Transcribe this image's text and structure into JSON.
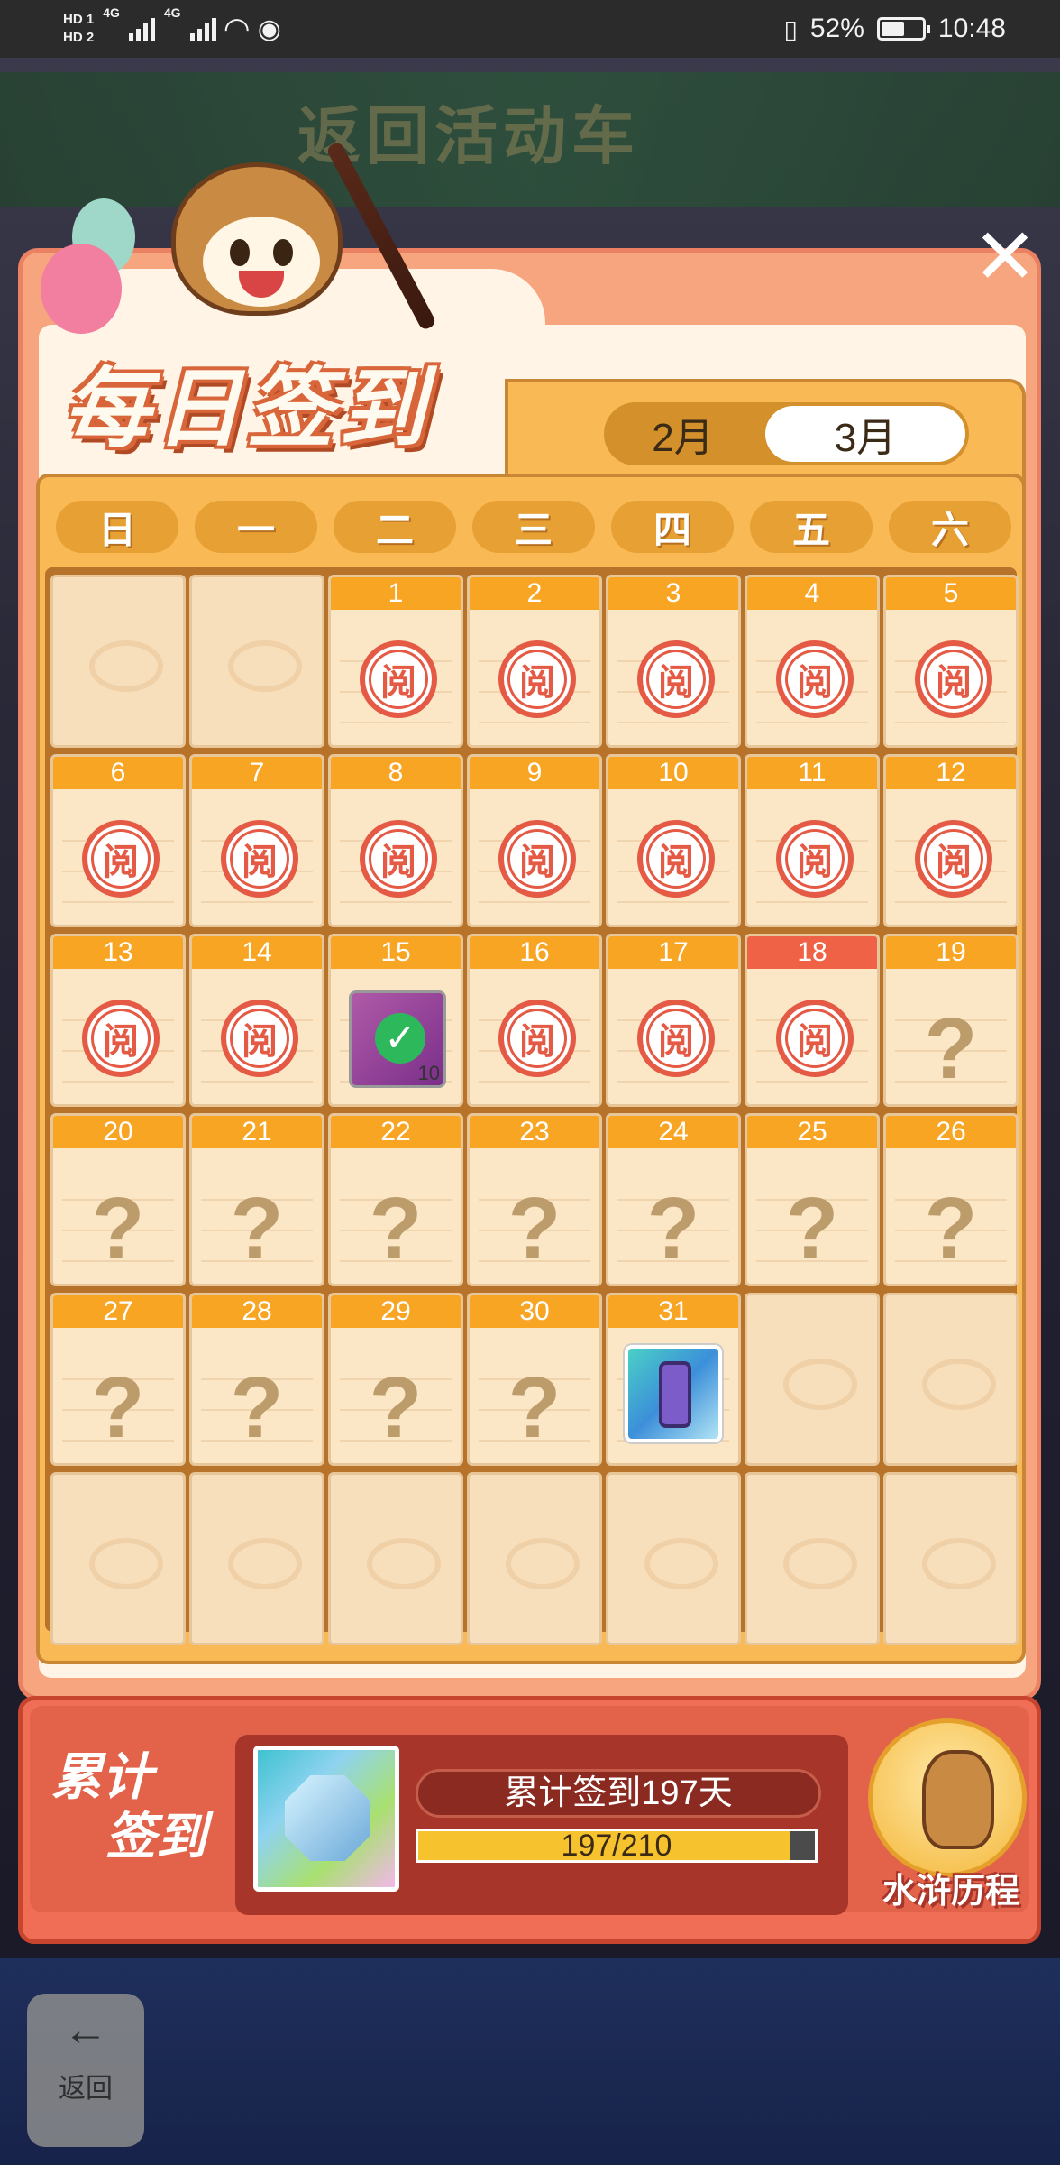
{
  "status_bar": {
    "sim1": "HD 1",
    "sim2": "HD 2",
    "net1": "4G",
    "net2": "4G",
    "battery": "52%",
    "time": "10:48"
  },
  "background": {
    "banner_title": "返回活动车",
    "back_label": "返回"
  },
  "header": {
    "title": "每日签到",
    "close_label": "✕"
  },
  "month_toggle": {
    "prev": "2月",
    "current": "3月"
  },
  "weekdays": [
    "日",
    "一",
    "二",
    "三",
    "四",
    "五",
    "六"
  ],
  "stamp_text": "阅",
  "unknown_text": "?",
  "calendar": {
    "today": 18,
    "cells": [
      {
        "day": "",
        "type": "empty"
      },
      {
        "day": "",
        "type": "empty"
      },
      {
        "day": "1",
        "type": "signed"
      },
      {
        "day": "2",
        "type": "signed"
      },
      {
        "day": "3",
        "type": "signed"
      },
      {
        "day": "4",
        "type": "signed"
      },
      {
        "day": "5",
        "type": "signed"
      },
      {
        "day": "6",
        "type": "signed"
      },
      {
        "day": "7",
        "type": "signed"
      },
      {
        "day": "8",
        "type": "signed"
      },
      {
        "day": "9",
        "type": "signed"
      },
      {
        "day": "10",
        "type": "signed"
      },
      {
        "day": "11",
        "type": "signed"
      },
      {
        "day": "12",
        "type": "signed"
      },
      {
        "day": "13",
        "type": "signed"
      },
      {
        "day": "14",
        "type": "signed"
      },
      {
        "day": "15",
        "type": "reward-claimed",
        "reward_count": "10"
      },
      {
        "day": "16",
        "type": "signed"
      },
      {
        "day": "17",
        "type": "signed"
      },
      {
        "day": "18",
        "type": "signed",
        "today": true
      },
      {
        "day": "19",
        "type": "unknown"
      },
      {
        "day": "20",
        "type": "unknown"
      },
      {
        "day": "21",
        "type": "unknown"
      },
      {
        "day": "22",
        "type": "unknown"
      },
      {
        "day": "23",
        "type": "unknown"
      },
      {
        "day": "24",
        "type": "unknown"
      },
      {
        "day": "25",
        "type": "unknown"
      },
      {
        "day": "26",
        "type": "unknown"
      },
      {
        "day": "27",
        "type": "unknown"
      },
      {
        "day": "28",
        "type": "unknown"
      },
      {
        "day": "29",
        "type": "unknown"
      },
      {
        "day": "30",
        "type": "unknown"
      },
      {
        "day": "31",
        "type": "reward-hourglass"
      },
      {
        "day": "",
        "type": "empty"
      },
      {
        "day": "",
        "type": "empty"
      },
      {
        "day": "",
        "type": "empty"
      },
      {
        "day": "",
        "type": "empty"
      },
      {
        "day": "",
        "type": "empty"
      },
      {
        "day": "",
        "type": "empty"
      },
      {
        "day": "",
        "type": "empty"
      },
      {
        "day": "",
        "type": "empty"
      },
      {
        "day": "",
        "type": "empty"
      }
    ]
  },
  "accumulate": {
    "label_line1": "累计",
    "label_line2": "签到",
    "days_text": "累计签到197天",
    "progress_text": "197/210",
    "progress_value": 197,
    "progress_max": 210
  },
  "history": {
    "label": "水浒历程"
  },
  "colors": {
    "panel": "#f6a57e",
    "calendar_bg": "#f9b955",
    "day_header": "#f8a524",
    "today_header": "#f06245",
    "stamp": "#e45a44",
    "progress_fill": "#f6c22d"
  }
}
